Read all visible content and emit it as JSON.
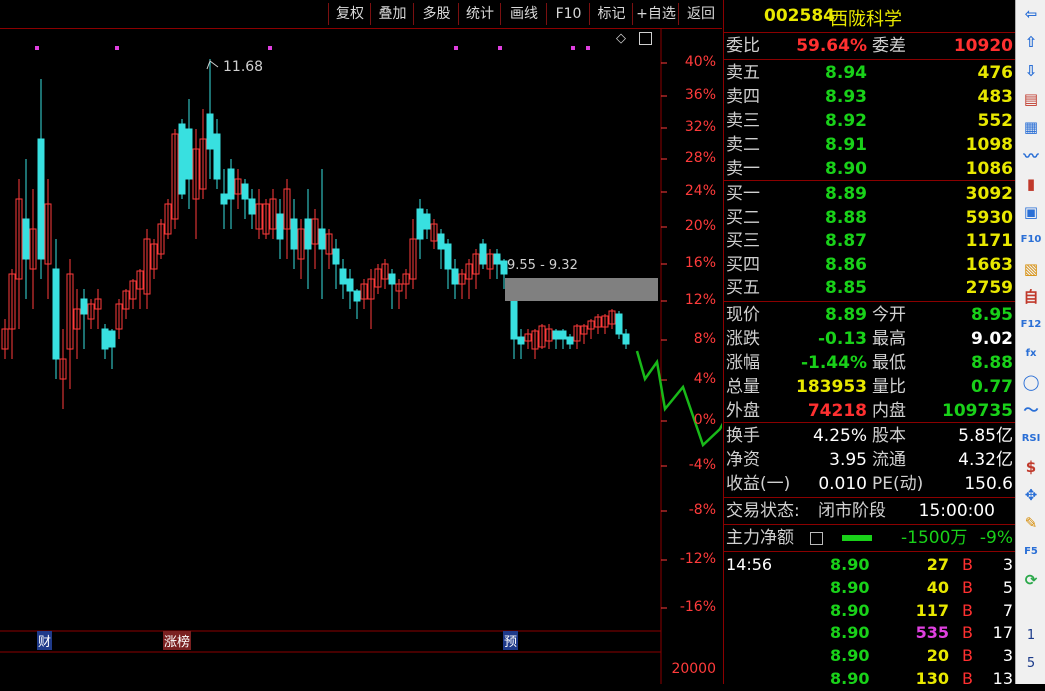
{
  "toolbar": {
    "buttons": [
      "复权",
      "叠加",
      "多股",
      "统计",
      "画线",
      "F10",
      "标记",
      "+自选",
      "返回"
    ]
  },
  "chart": {
    "axis_labels": [
      "40%",
      "36%",
      "32%",
      "28%",
      "24%",
      "20%",
      "16%",
      "12%",
      "8%",
      "4%",
      "0%",
      "-4%",
      "-8%",
      "-12%",
      "-16%"
    ],
    "volume_label": "20000",
    "high_marker": "11.68",
    "gap_label": "9.55 - 9.32",
    "badges": [
      "财",
      "涨榜",
      "预"
    ],
    "colors": {
      "up": "#ff3b3b",
      "down": "#38e0e0",
      "forecast": "#19b919",
      "dots": "#e040e0",
      "gap": "#808080"
    }
  },
  "quote": {
    "code": "002584",
    "name": "西陇科学",
    "weibi_label": "委比",
    "weibi": "59.64%",
    "weicha_label": "委差",
    "weicha": "10920",
    "asks": [
      {
        "label": "卖五",
        "price": "8.94",
        "vol": "476"
      },
      {
        "label": "卖四",
        "price": "8.93",
        "vol": "483"
      },
      {
        "label": "卖三",
        "price": "8.92",
        "vol": "552"
      },
      {
        "label": "卖二",
        "price": "8.91",
        "vol": "1098"
      },
      {
        "label": "卖一",
        "price": "8.90",
        "vol": "1086"
      }
    ],
    "bids": [
      {
        "label": "买一",
        "price": "8.89",
        "vol": "3092"
      },
      {
        "label": "买二",
        "price": "8.88",
        "vol": "5930"
      },
      {
        "label": "买三",
        "price": "8.87",
        "vol": "1171"
      },
      {
        "label": "买四",
        "price": "8.86",
        "vol": "1663"
      },
      {
        "label": "买五",
        "price": "8.85",
        "vol": "2759"
      }
    ],
    "stats": [
      {
        "l1": "现价",
        "v1": "8.89",
        "c1": "green",
        "l2": "今开",
        "v2": "8.95",
        "c2": "green"
      },
      {
        "l1": "涨跌",
        "v1": "-0.13",
        "c1": "green",
        "l2": "最高",
        "v2": "9.02",
        "c2": "white"
      },
      {
        "l1": "涨幅",
        "v1": "-1.44%",
        "c1": "green",
        "l2": "最低",
        "v2": "8.88",
        "c2": "green"
      },
      {
        "l1": "总量",
        "v1": "183953",
        "c1": "yellow",
        "l2": "量比",
        "v2": "0.77",
        "c2": "green"
      },
      {
        "l1": "外盘",
        "v1": "74218",
        "c1": "red",
        "l2": "内盘",
        "v2": "109735",
        "c2": "green"
      }
    ],
    "stats2": [
      {
        "l1": "换手",
        "v1": "4.25%",
        "l2": "股本",
        "v2": "5.85亿"
      },
      {
        "l1": "净资",
        "v1": "3.95",
        "l2": "流通",
        "v2": "4.32亿"
      },
      {
        "l1": "收益(一)",
        "v1": "0.010",
        "l2": "PE(动)",
        "v2": "150.6"
      }
    ],
    "status_label": "交易状态:",
    "status_value": "闭市阶段",
    "status_time": "15:00:00",
    "main_label": "主力净额",
    "main_value": "-1500万",
    "main_pct": "-9%",
    "ticks": [
      {
        "time": "14:56",
        "price": "8.90",
        "vol": "27",
        "vc": "yellow",
        "bs": "B",
        "n": "3"
      },
      {
        "time": "",
        "price": "8.90",
        "vol": "40",
        "vc": "yellow",
        "bs": "B",
        "n": "5"
      },
      {
        "time": "",
        "price": "8.90",
        "vol": "117",
        "vc": "yellow",
        "bs": "B",
        "n": "7"
      },
      {
        "time": "",
        "price": "8.90",
        "vol": "535",
        "vc": "purple",
        "bs": "B",
        "n": "17"
      },
      {
        "time": "",
        "price": "8.90",
        "vol": "20",
        "vc": "yellow",
        "bs": "B",
        "n": "3"
      },
      {
        "time": "",
        "price": "8.90",
        "vol": "130",
        "vc": "yellow",
        "bs": "B",
        "n": "13"
      }
    ]
  },
  "iconbar": {
    "icons": [
      "arrow-left-icon",
      "arrow-up-icon",
      "arrow-down-icon",
      "report-icon",
      "grid-icon",
      "line-chart-icon",
      "candle-icon",
      "layout-icon",
      "f10-icon",
      "news-icon",
      "self-icon",
      "f12-icon",
      "fx-icon",
      "circle-icon",
      "trend-icon",
      "rsi-icon",
      "dollar-icon",
      "move-icon",
      "pen-icon",
      "f5-icon",
      "refresh-icon"
    ],
    "labels": [
      "1",
      "5"
    ]
  }
}
